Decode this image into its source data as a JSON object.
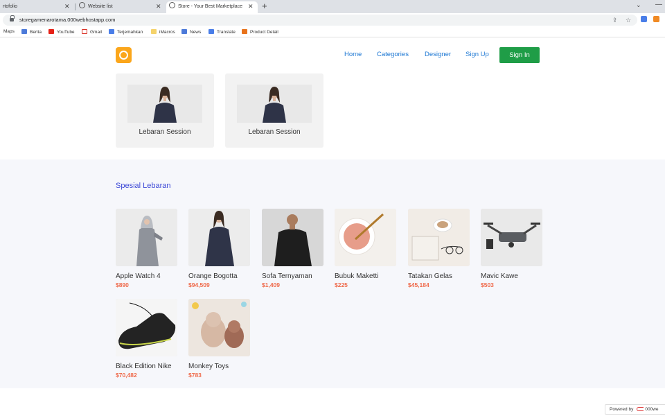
{
  "browser": {
    "tabs": [
      {
        "title": "rtofolio"
      },
      {
        "title": "Website list"
      },
      {
        "title": "Store - Your Best Marketplace"
      }
    ],
    "tab_close_glyph": "✕",
    "new_tab_glyph": "+",
    "url": "storegamenarotama.000webhostapp.com",
    "bookmarks": [
      "Maps",
      "Berita",
      "YouTube",
      "Gmail",
      "Terjemahkan",
      "iMacros",
      "News",
      "Translate",
      "Product Detail"
    ]
  },
  "nav": {
    "links": [
      "Home",
      "Categories",
      "Designer",
      "Sign Up"
    ],
    "signin_label": "Sign In"
  },
  "categories": [
    {
      "label": "Lebaran Session"
    },
    {
      "label": "Lebaran Session"
    }
  ],
  "section": {
    "title": "Spesial Lebaran",
    "products": [
      {
        "name": "Apple Watch 4",
        "price": "$890"
      },
      {
        "name": "Orange Bogotta",
        "price": "$94,509"
      },
      {
        "name": "Sofa Ternyaman",
        "price": "$1,409"
      },
      {
        "name": "Bubuk Maketti",
        "price": "$225"
      },
      {
        "name": "Tatakan Gelas",
        "price": "$45,184"
      },
      {
        "name": "Mavic Kawe",
        "price": "$503"
      },
      {
        "name": "Black Edition Nike",
        "price": "$70,482"
      },
      {
        "name": "Monkey Toys",
        "price": "$783"
      }
    ]
  },
  "powered": {
    "label": "Powered by",
    "brand": "000we"
  },
  "colors": {
    "accent": "#1c77d3",
    "signin": "#1f9d47",
    "price": "#ef6a4b",
    "section_title": "#3b47d6",
    "logo": "#fba61b"
  }
}
